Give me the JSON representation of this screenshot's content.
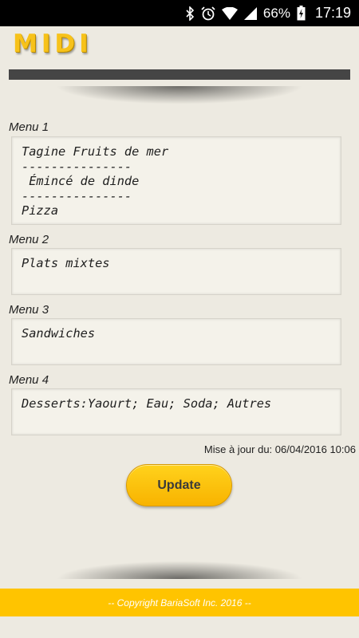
{
  "status_bar": {
    "battery_percent": "66%",
    "time": "17:19",
    "icons": [
      "bluetooth-icon",
      "alarm-icon",
      "wifi-icon",
      "signal-icon",
      "battery-charging-icon"
    ]
  },
  "app": {
    "title": "MIDI",
    "accent_color": "#f7c21a"
  },
  "menus": [
    {
      "label": "Menu 1",
      "text": "Tagine Fruits de mer\n---------------\n Émincé de dinde\n---------------\nPizza"
    },
    {
      "label": "Menu 2",
      "text": "Plats mixtes"
    },
    {
      "label": "Menu 3",
      "text": "Sandwiches"
    },
    {
      "label": "Menu 4",
      "text": "Desserts:Yaourt; Eau; Soda; Autres"
    }
  ],
  "last_update": "Mise à jour du: 06/04/2016 10:06",
  "update_button_label": "Update",
  "footer": {
    "copyright": "-- Copyright BariaSoft Inc. 2016 --",
    "color": "#ffc400"
  }
}
